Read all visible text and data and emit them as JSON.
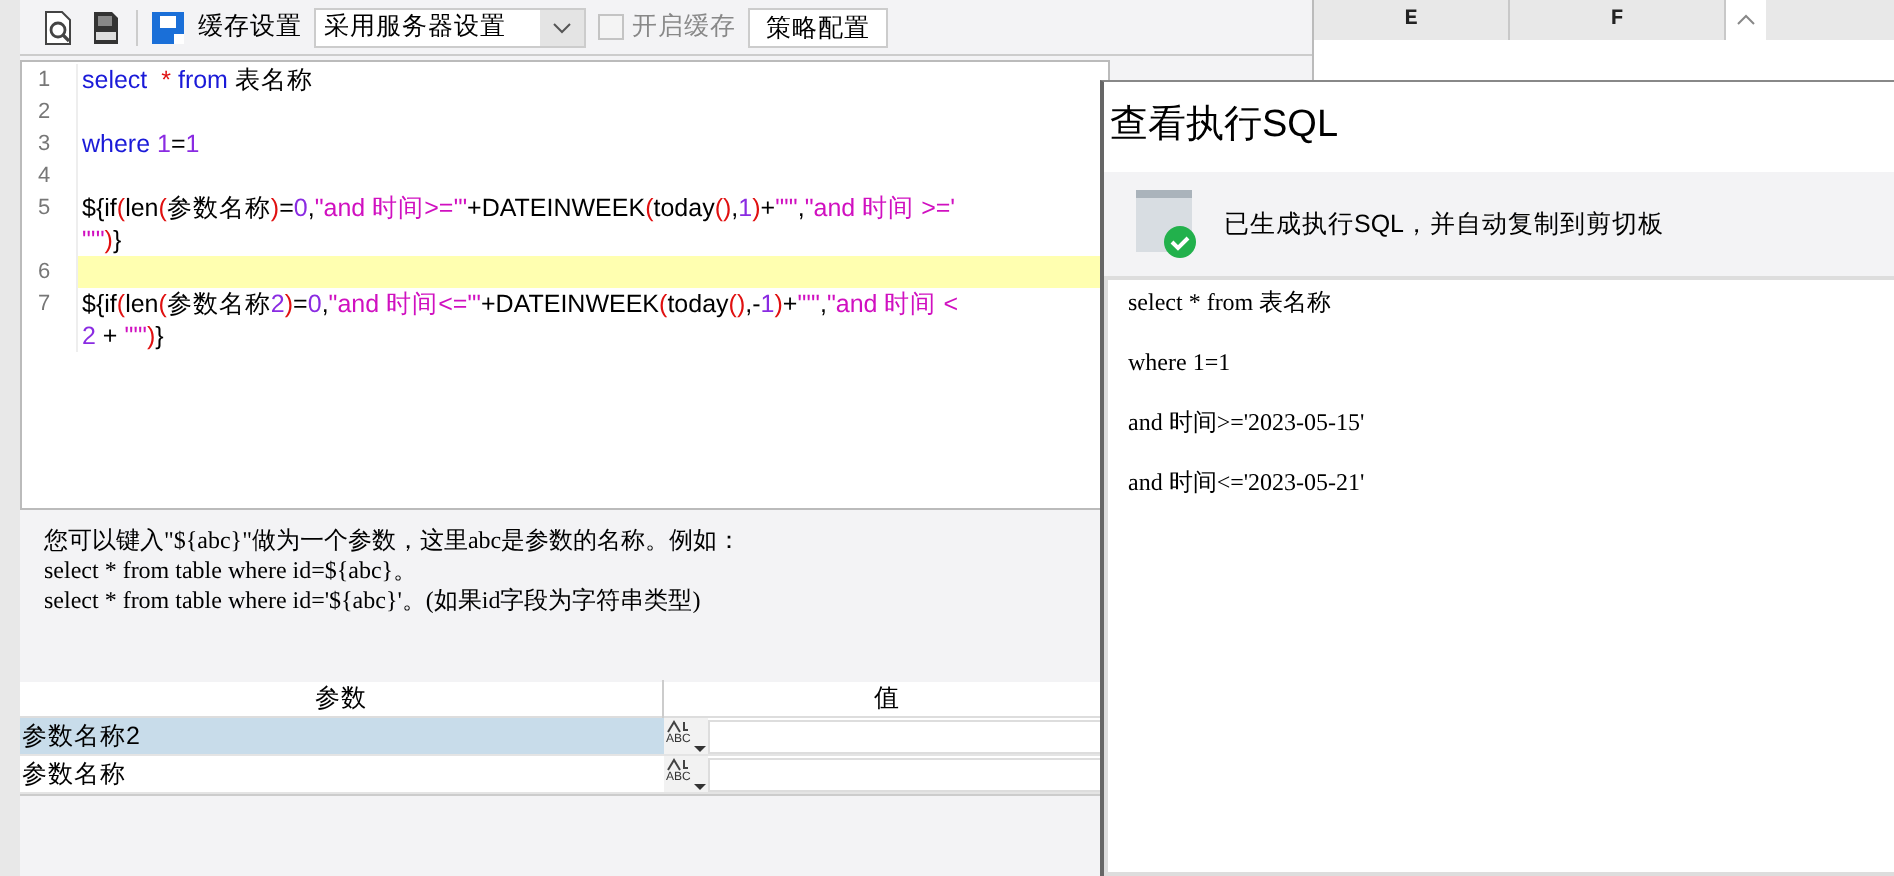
{
  "toolbar": {
    "cache_label": "缓存设置",
    "cache_select": {
      "value": "采用服务器设置"
    },
    "cache_checkbox": {
      "label": "开启缓存",
      "checked": false,
      "disabled": true
    },
    "strategy_button": "策略配置"
  },
  "editor": {
    "lines": [
      {
        "number": "1",
        "highlighted": false,
        "rows": [
          "select  * from 表名称"
        ]
      },
      {
        "number": "2",
        "highlighted": false
      },
      {
        "number": "3",
        "highlighted": false,
        "rows": [
          "where 1=1"
        ]
      },
      {
        "number": "4",
        "highlighted": false
      },
      {
        "number": "5",
        "highlighted": false,
        "rows": [
          "${if(len(参数名称)=0,\"and 时间>='\"+DATEINWEEK(today(),1)+\"'\",\"and 时间 >='",
          "\"'\")}"
        ]
      },
      {
        "number": "6",
        "highlighted": true
      },
      {
        "number": "7",
        "highlighted": false,
        "rows": [
          "${if(len(参数名称2)=0,\"and 时间<='\"+DATEINWEEK(today(),-1)+\"'\",\"and 时间 <",
          "2 + \"'\")}"
        ]
      }
    ]
  },
  "help_text": [
    "您可以键入\"${abc}\"做为一个参数，这里abc是参数的名称。例如：",
    "select * from table where id=${abc}。",
    "select * from table where id='${abc}'。(如果id字段为字符串类型)"
  ],
  "params": {
    "columns": [
      "参数",
      "值"
    ],
    "rows": [
      {
        "name": "参数名称2",
        "selected": true,
        "type_label": "ABC"
      },
      {
        "name": "参数名称",
        "selected": false,
        "type_label": "ABC"
      }
    ]
  },
  "sheet": {
    "columns": [
      "E",
      "F"
    ]
  },
  "dialog": {
    "title": "查看执行SQL",
    "message": "已生成执行SQL，并自动复制到剪切板",
    "sql_lines": [
      "select  * from 表名称",
      "where 1=1",
      "and 时间>='2023-05-15'",
      "and 时间<='2023-05-21'"
    ]
  }
}
